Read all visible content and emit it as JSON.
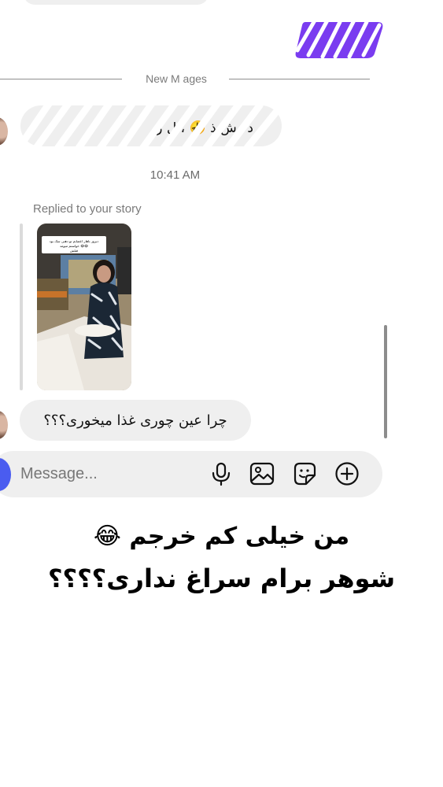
{
  "thread": {
    "divider_label": "New M    ages",
    "timestamp": "10:41 AM",
    "received_obscured_text": "د وش ذ 🤣 ، ل ز ",
    "reply_label": "Replied to your story",
    "story_caption": "دیروز ناهار اعصابم تو دهنی سک بود خواستم میومد 😂😂 قتلش",
    "reply_message": "چرا عین چوری غذا میخوری؟؟؟"
  },
  "composer": {
    "placeholder": "Message...",
    "icons": [
      "camera-icon",
      "microphone-icon",
      "gallery-icon",
      "sticker-icon",
      "add-icon"
    ]
  },
  "caption": {
    "line1": "من خیلی کم خرجم 😂",
    "line2": "شوهر برام سراغ نداری؟؟؟؟"
  },
  "colors": {
    "sent_bubble": "#7a3cf0",
    "received_bubble": "#efefef",
    "camera_button": "#4a5cf0",
    "divider_text": "#7b7b7b"
  }
}
